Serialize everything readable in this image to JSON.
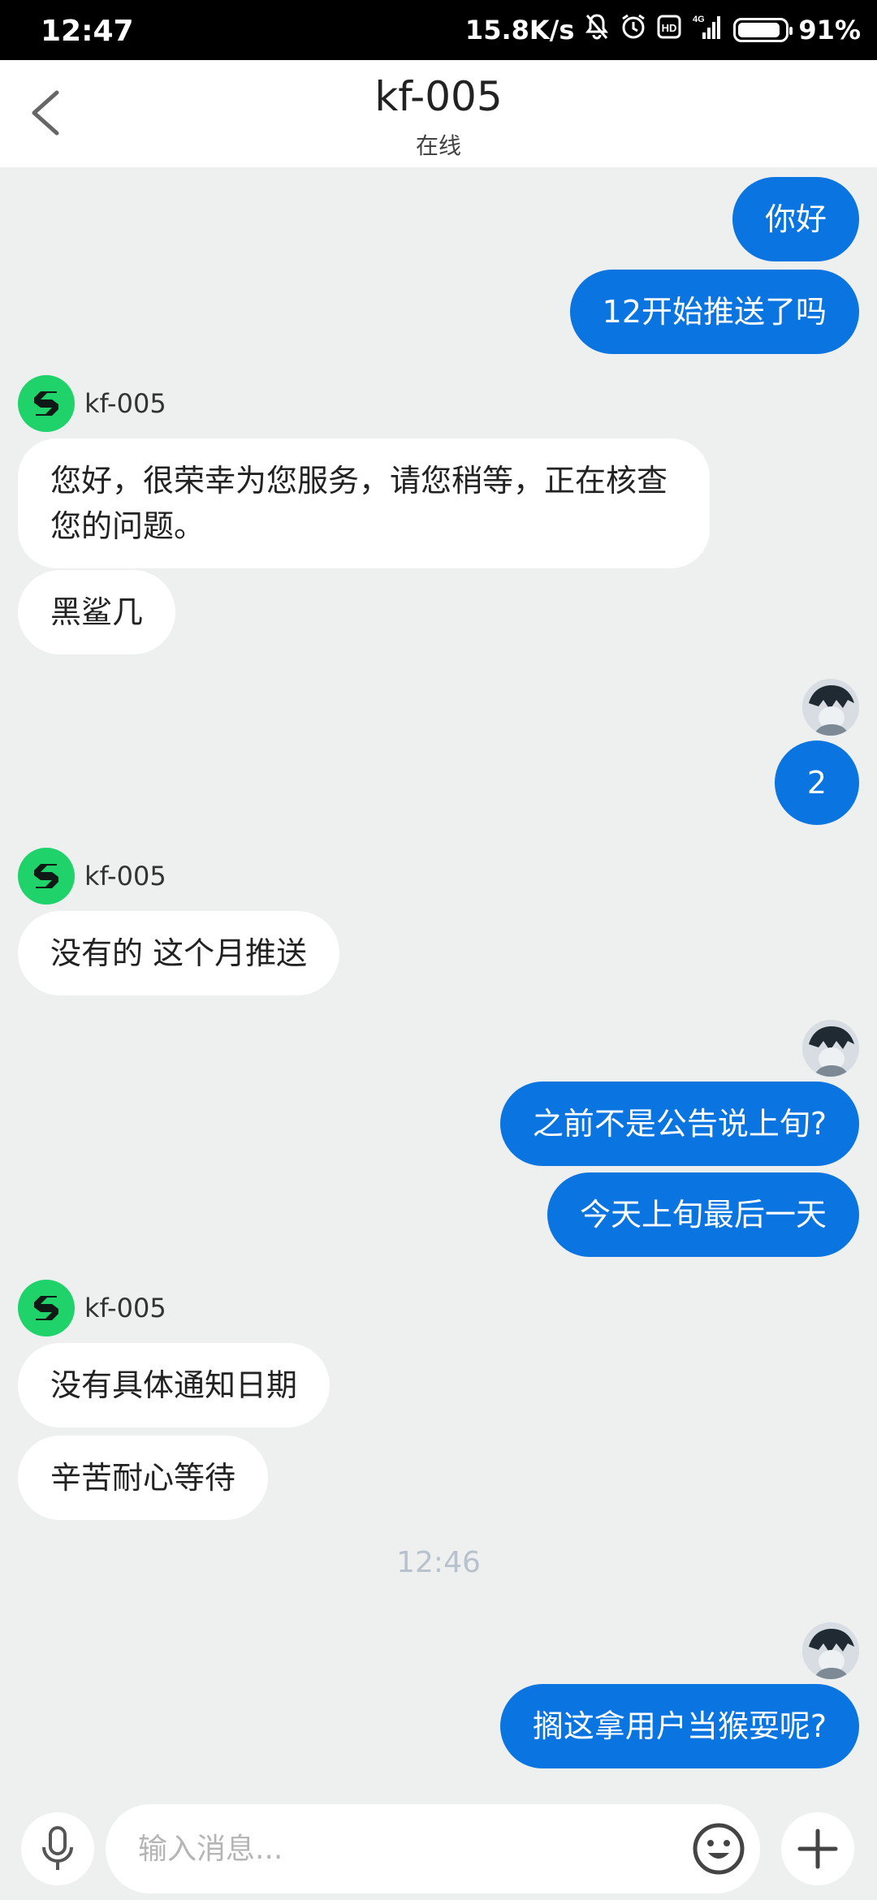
{
  "status_bar": {
    "time": "12:47",
    "speed": "15.8K/s",
    "signal_label": "4G",
    "hd_label": "HD",
    "battery": "91%",
    "battery_level": 0.91
  },
  "header": {
    "title": "kf-005",
    "subtitle": "在线"
  },
  "messages": [
    {
      "text": "你好"
    },
    {
      "text": "12开始推送了吗"
    },
    {
      "agent": "kf-005"
    },
    {
      "text": "您好，很荣幸为您服务，请您稍等，正在核查您的问题。"
    },
    {
      "text": "黑鲨几"
    },
    {
      "text": "2"
    },
    {
      "agent": "kf-005"
    },
    {
      "text": "没有的 这个月推送"
    },
    {
      "text": "之前不是公告说上旬?"
    },
    {
      "text": "今天上旬最后一天"
    },
    {
      "agent": "kf-005"
    },
    {
      "text": "没有具体通知日期"
    },
    {
      "text": "辛苦耐心等待"
    },
    {
      "time": "12:46"
    },
    {
      "text": "搁这拿用户当猴耍呢?"
    }
  ],
  "input": {
    "placeholder": "输入消息..."
  },
  "colors": {
    "outgoing_bubble": "#0a74e0",
    "incoming_bubble": "#ffffff",
    "agent_avatar": "#1fd26a",
    "background": "#eef0f0"
  },
  "icons": [
    "back-arrow-icon",
    "mute-bell-icon",
    "alarm-icon",
    "signal-icon",
    "battery-icon",
    "agent-logo-icon",
    "user-avatar",
    "microphone-icon",
    "emoji-icon",
    "plus-icon"
  ]
}
